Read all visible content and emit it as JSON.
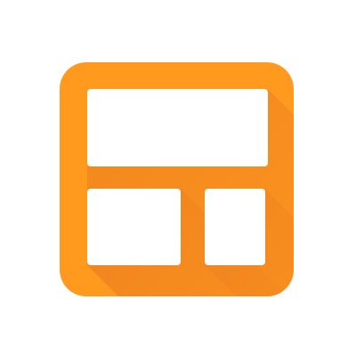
{
  "icon": {
    "name": "dashboard-layout-icon",
    "colors": {
      "primary": "#FF9A1F",
      "shadow": "#E8761E",
      "panel": "#FFFFFF",
      "background": "#FFFFFF"
    }
  }
}
